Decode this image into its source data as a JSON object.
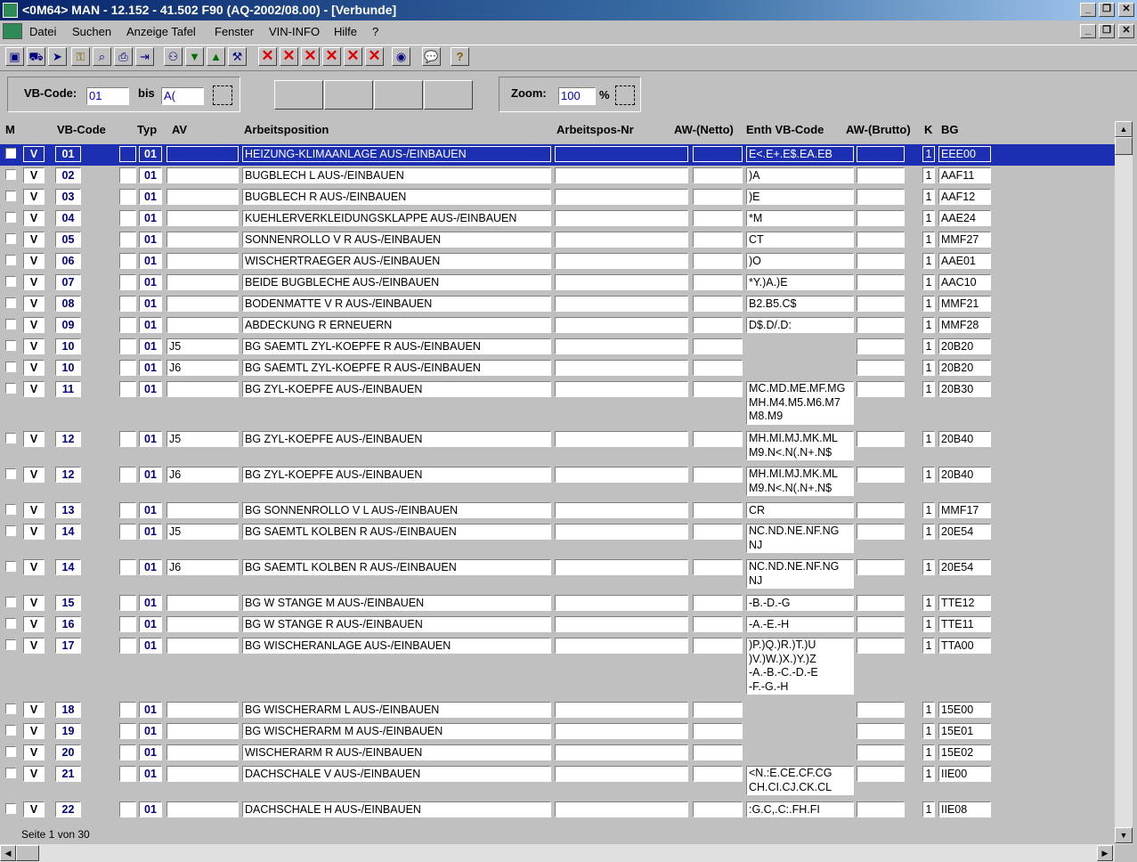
{
  "window": {
    "title": "<0M64> MAN  - 12.152 - 41.502 F90  (AQ-2002/08.00) - [Verbunde]"
  },
  "menu": [
    "Datei",
    "Suchen",
    "Anzeige Tafel",
    "Fenster",
    "VIN-INFO",
    "Hilfe",
    "?"
  ],
  "filter": {
    "vb_label": "VB-Code:",
    "vb_from": "01",
    "bis_label": "bis",
    "vb_to": "A(",
    "zoom_label": "Zoom:",
    "zoom_value": "100",
    "zoom_unit": "%"
  },
  "columns": {
    "m": "M",
    "vb": "VB-Code",
    "typ": "Typ",
    "av": "AV",
    "arbeitsposition": "Arbeitsposition",
    "arbeitspos_nr": "Arbeitspos-Nr",
    "aw_netto": "AW-(Netto)",
    "enth": "Enth VB-Code",
    "aw_brutto": "AW-(Brutto)",
    "k": "K",
    "bg": "BG"
  },
  "rows": [
    {
      "v": "V",
      "code": "01",
      "typ": "01",
      "av": "",
      "pos": "HEIZUNG-KLIMAANLAGE AUS-/EINBAUEN",
      "enth": "E<.E+.E$.EA.EB",
      "k": "1",
      "bg": "EEE00",
      "selected": true
    },
    {
      "v": "V",
      "code": "02",
      "typ": "01",
      "av": "",
      "pos": "BUGBLECH L AUS-/EINBAUEN",
      "enth": ")A",
      "k": "1",
      "bg": "AAF11"
    },
    {
      "v": "V",
      "code": "03",
      "typ": "01",
      "av": "",
      "pos": "BUGBLECH R AUS-/EINBAUEN",
      "enth": ")E",
      "k": "1",
      "bg": "AAF12"
    },
    {
      "v": "V",
      "code": "04",
      "typ": "01",
      "av": "",
      "pos": "KUEHLERVERKLEIDUNGSKLAPPE AUS-/EINBAUEN",
      "enth": "*M",
      "k": "1",
      "bg": "AAE24"
    },
    {
      "v": "V",
      "code": "05",
      "typ": "01",
      "av": "",
      "pos": "SONNENROLLO V R AUS-/EINBAUEN",
      "enth": "CT",
      "k": "1",
      "bg": "MMF27"
    },
    {
      "v": "V",
      "code": "06",
      "typ": "01",
      "av": "",
      "pos": "WISCHERTRAEGER  AUS-/EINBAUEN",
      "enth": ")O",
      "k": "1",
      "bg": "AAE01"
    },
    {
      "v": "V",
      "code": "07",
      "typ": "01",
      "av": "",
      "pos": "BEIDE BUGBLECHE AUS-/EINBAUEN",
      "enth": "*Y.)A.)E",
      "k": "1",
      "bg": "AAC10"
    },
    {
      "v": "V",
      "code": "08",
      "typ": "01",
      "av": "",
      "pos": "BODENMATTE V R AUS-/EINBAUEN",
      "enth": "B2.B5.C$",
      "k": "1",
      "bg": "MMF21"
    },
    {
      "v": "V",
      "code": "09",
      "typ": "01",
      "av": "",
      "pos": "ABDECKUNG R ERNEUERN",
      "enth": "D$.D/.D:",
      "k": "1",
      "bg": "MMF28"
    },
    {
      "v": "V",
      "code": "10",
      "typ": "01",
      "av": "J5",
      "pos": "BG SAEMTL ZYL-KOEPFE R AUS-/EINBAUEN",
      "enth": null,
      "k": "1",
      "bg": "20B20"
    },
    {
      "v": "V",
      "code": "10",
      "typ": "01",
      "av": "J6",
      "pos": "BG SAEMTL ZYL-KOEPFE R AUS-/EINBAUEN",
      "enth": null,
      "k": "1",
      "bg": "20B20"
    },
    {
      "v": "V",
      "code": "11",
      "typ": "01",
      "av": "",
      "pos": "BG ZYL-KOEPFE AUS-/EINBAUEN",
      "enth": "MC.MD.ME.MF.MG\nMH.M4.M5.M6.M7\nM8.M9",
      "k": "1",
      "bg": "20B30"
    },
    {
      "v": "V",
      "code": "12",
      "typ": "01",
      "av": "J5",
      "pos": "BG ZYL-KOEPFE AUS-/EINBAUEN",
      "enth": "MH.MI.MJ.MK.ML\nM9.N<.N(.N+.N$",
      "k": "1",
      "bg": "20B40"
    },
    {
      "v": "V",
      "code": "12",
      "typ": "01",
      "av": "J6",
      "pos": "BG ZYL-KOEPFE AUS-/EINBAUEN",
      "enth": "MH.MI.MJ.MK.ML\nM9.N<.N(.N+.N$",
      "k": "1",
      "bg": "20B40"
    },
    {
      "v": "V",
      "code": "13",
      "typ": "01",
      "av": "",
      "pos": "BG SONNENROLLO V L AUS-/EINBAUEN",
      "enth": "CR",
      "k": "1",
      "bg": "MMF17"
    },
    {
      "v": "V",
      "code": "14",
      "typ": "01",
      "av": "J5",
      "pos": "BG SAEMTL KOLBEN R AUS-/EINBAUEN",
      "enth": "NC.ND.NE.NF.NG\nNJ",
      "k": "1",
      "bg": "20E54"
    },
    {
      "v": "V",
      "code": "14",
      "typ": "01",
      "av": "J6",
      "pos": "BG SAEMTL KOLBEN R AUS-/EINBAUEN",
      "enth": "NC.ND.NE.NF.NG\nNJ",
      "k": "1",
      "bg": "20E54"
    },
    {
      "v": "V",
      "code": "15",
      "typ": "01",
      "av": "",
      "pos": "BG W STANGE M AUS-/EINBAUEN",
      "enth": "-B.-D.-G",
      "k": "1",
      "bg": "TTE12"
    },
    {
      "v": "V",
      "code": "16",
      "typ": "01",
      "av": "",
      "pos": "BG W STANGE R AUS-/EINBAUEN",
      "enth": "-A.-E.-H",
      "k": "1",
      "bg": "TTE11"
    },
    {
      "v": "V",
      "code": "17",
      "typ": "01",
      "av": "",
      "pos": "BG WISCHERANLAGE AUS-/EINBAUEN",
      "enth": ")P.)Q.)R.)T.)U\n)V.)W.)X.)Y.)Z\n-A.-B.-C.-D.-E\n-F.-G.-H",
      "k": "1",
      "bg": "TTA00"
    },
    {
      "v": "V",
      "code": "18",
      "typ": "01",
      "av": "",
      "pos": "BG WISCHERARM L AUS-/EINBAUEN",
      "enth": null,
      "k": "1",
      "bg": "15E00"
    },
    {
      "v": "V",
      "code": "19",
      "typ": "01",
      "av": "",
      "pos": "BG WISCHERARM M AUS-/EINBAUEN",
      "enth": null,
      "k": "1",
      "bg": "15E01"
    },
    {
      "v": "V",
      "code": "20",
      "typ": "01",
      "av": "",
      "pos": "WISCHERARM R AUS-/EINBAUEN",
      "enth": null,
      "k": "1",
      "bg": "15E02"
    },
    {
      "v": "V",
      "code": "21",
      "typ": "01",
      "av": "",
      "pos": "DACHSCHALE V AUS-/EINBAUEN",
      "enth": "<N.:E.CE.CF.CG\nCH.CI.CJ.CK.CL",
      "k": "1",
      "bg": "IIE00"
    },
    {
      "v": "V",
      "code": "22",
      "typ": "01",
      "av": "",
      "pos": "DACHSCHALE H AUS-/EINBAUEN",
      "enth": ":G.C,.C:.FH.FI",
      "k": "1",
      "bg": "IIE08"
    }
  ],
  "status": {
    "page": "Seite 1 von 30"
  },
  "icons": {
    "close": "close-x-icon",
    "help": "question-icon",
    "speech": "speech-bubble-icon"
  }
}
